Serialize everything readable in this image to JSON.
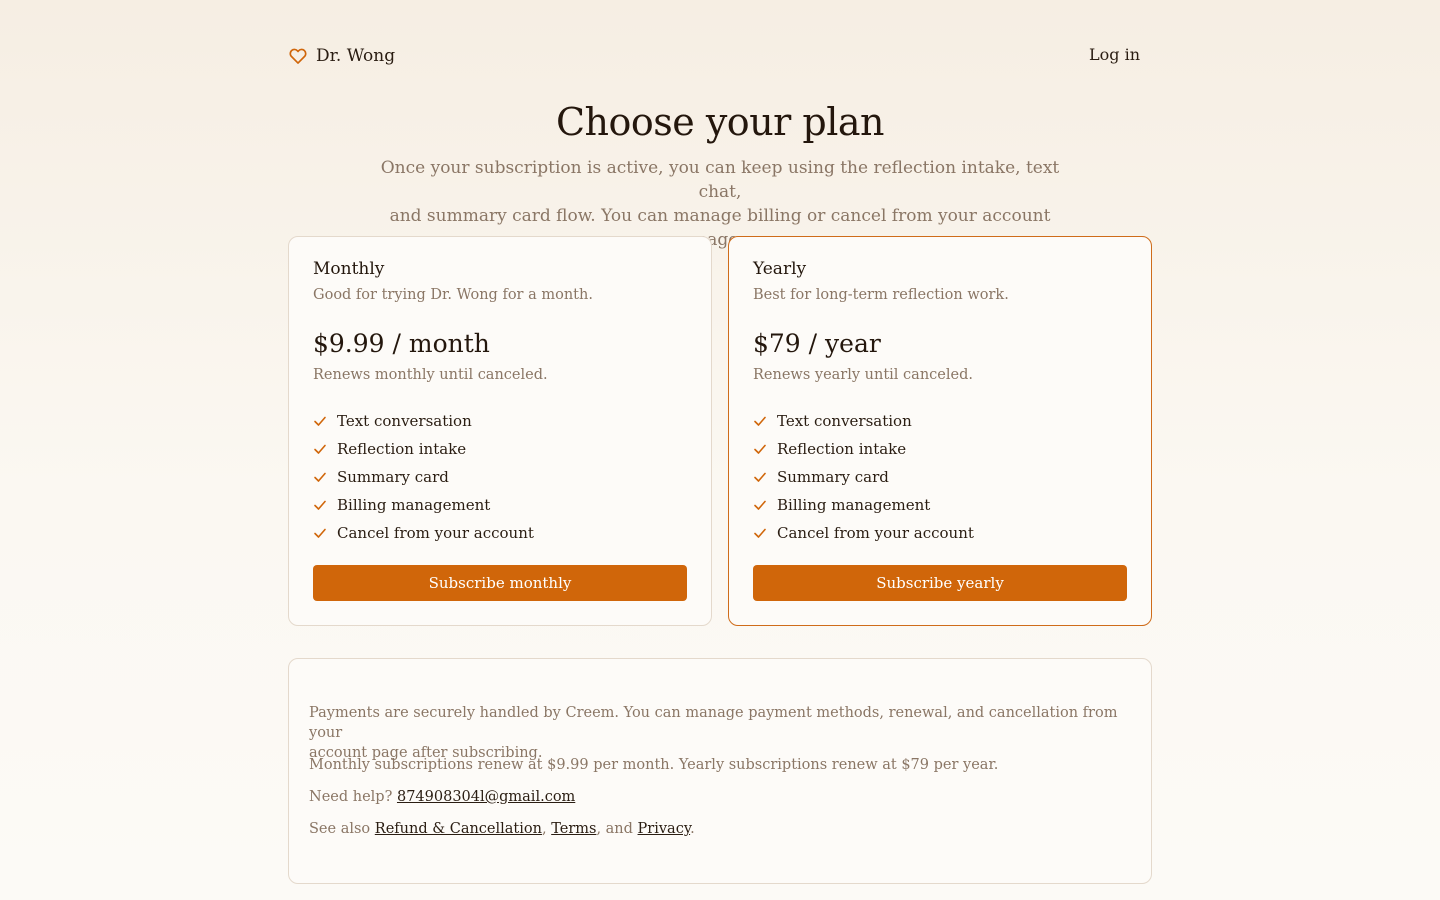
{
  "header": {
    "brand_name": "Dr. Wong",
    "brand_icon": "heart-icon",
    "login_label": "Log in"
  },
  "hero": {
    "title": "Choose your plan",
    "subtitle_line1": "Once your subscription is active, you can keep using the reflection intake, text chat,",
    "subtitle_line2": "and summary card flow. You can manage billing or cancel from your account page."
  },
  "plans": [
    {
      "name": "Monthly",
      "description": "Good for trying Dr. Wong for a month.",
      "price": "$9.99 / month",
      "renewal": "Renews monthly until canceled.",
      "features": [
        "Text conversation",
        "Reflection intake",
        "Summary card",
        "Billing management",
        "Cancel from your account"
      ],
      "cta": "Subscribe monthly"
    },
    {
      "name": "Yearly",
      "description": "Best for long-term reflection work.",
      "price": "$79 / year",
      "renewal": "Renews yearly until canceled.",
      "features": [
        "Text conversation",
        "Reflection intake",
        "Summary card",
        "Billing management",
        "Cancel from your account"
      ],
      "cta": "Subscribe yearly",
      "highlighted": true
    }
  ],
  "info": {
    "payments_line1": "Payments are securely handled by Creem. You can manage payment methods, renewal, and cancellation from your",
    "payments_line2": "account page after subscribing.",
    "renewal_text": "Monthly subscriptions renew at $9.99 per month. Yearly subscriptions renew at $79 per year.",
    "help_prefix": "Need help?",
    "help_email": "874908304l@gmail.com",
    "see_also_prefix": "See also",
    "refund_link": "Refund & Cancellation",
    "sep_comma": ",",
    "terms_link": "Terms",
    "sep_and": ", and",
    "privacy_link": "Privacy",
    "period": "."
  },
  "colors": {
    "accent": "#d0660a",
    "highlight_border": "#cf6c1a",
    "muted_text": "#8a7665",
    "text": "#2a1d12"
  }
}
